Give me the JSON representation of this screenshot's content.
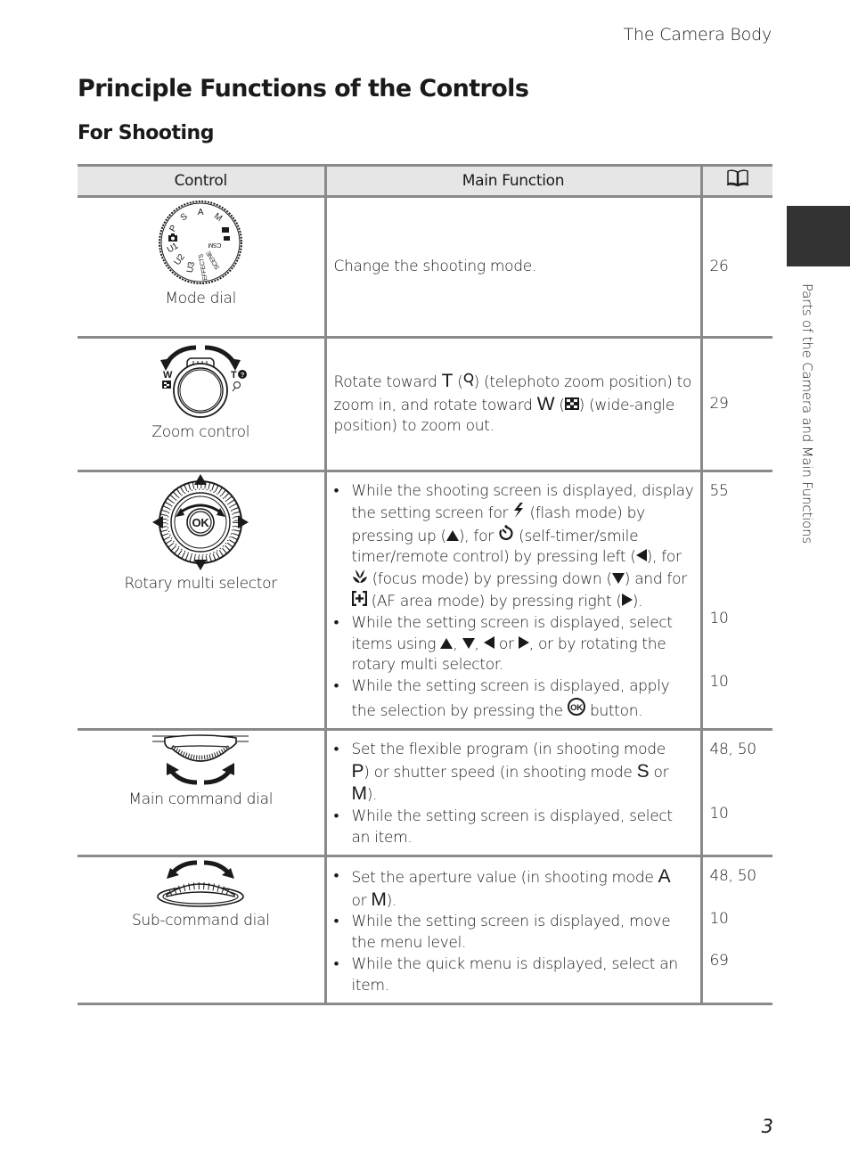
{
  "header": {
    "running_head": "The Camera Body",
    "page_title": "Principle Functions of the Controls",
    "section_title": "For Shooting"
  },
  "side_tab": {
    "label": "Parts of the Camera and Main Functions",
    "color": "#333333"
  },
  "page_number": "3",
  "table": {
    "columns": [
      "Control",
      "Main Function",
      "book-icon"
    ],
    "border_color": "#8a8a8a",
    "header_bg": "#e6e6e6",
    "rows": [
      {
        "control": "Mode dial",
        "icon": "mode-dial-icon",
        "dial_labels": [
          "P",
          "S",
          "A",
          "M",
          "CSM",
          "SCENE",
          "EFFECTS",
          "U3",
          "U2",
          "U1"
        ],
        "function": "Change the shooting mode.",
        "refs": [
          "26"
        ]
      },
      {
        "control": "Zoom control",
        "icon": "zoom-control-icon",
        "dial_labels": [
          "W",
          "T"
        ],
        "function_parts": {
          "a": "Rotate toward ",
          "t_sym": "T",
          "b": " (",
          "c": ") (telephoto zoom position) to zoom in, and rotate toward ",
          "w_sym": "W",
          "d": " (",
          "e": ") (wide-angle position) to zoom out."
        },
        "refs": [
          "29"
        ]
      },
      {
        "control": "Rotary multi selector",
        "icon": "rotary-multi-selector-icon",
        "ok_label": "OK",
        "bullets": [
          {
            "parts": {
              "a": "While the shooting screen is displayed, display the setting screen for ",
              "b": " (flash mode) by pressing up (",
              "c": "), for ",
              "d": " (self-timer/smile timer/remote control) by pressing left (",
              "e": "), for ",
              "f": " (focus mode) by pressing down (",
              "g": ") and for ",
              "h": " (AF area mode) by pressing right (",
              "i": ")."
            },
            "ref": "55"
          },
          {
            "parts": {
              "a": "While the setting screen is displayed, select items using ",
              "b": ", ",
              "c": ", ",
              "d": " or ",
              "e": ", or by rotating the rotary multi selector."
            },
            "ref": "10"
          },
          {
            "parts": {
              "a": "While the setting screen is displayed, apply the selection by pressing the ",
              "b": " button."
            },
            "ref": "10"
          }
        ]
      },
      {
        "control": "Main command dial",
        "icon": "main-command-dial-icon",
        "bullets": [
          {
            "parts": {
              "a": "Set the flexible program (in shooting mode ",
              "p": "P",
              "b": ") or shutter speed (in shooting mode ",
              "s": "S",
              "c": " or ",
              "m": "M",
              "d": ")."
            },
            "ref": "48, 50"
          },
          {
            "text": "While the setting screen is displayed, select an item.",
            "ref": "10"
          }
        ]
      },
      {
        "control": "Sub-command dial",
        "icon": "sub-command-dial-icon",
        "bullets": [
          {
            "parts": {
              "a": "Set the aperture value (in shooting mode ",
              "amode": "A",
              "b": " or ",
              "m": "M",
              "c": ")."
            },
            "ref": "48, 50"
          },
          {
            "text": "While the setting screen is displayed, move the menu level.",
            "ref": "10"
          },
          {
            "text": "While the quick menu is displayed, select an item.",
            "ref": "69"
          }
        ]
      }
    ]
  }
}
